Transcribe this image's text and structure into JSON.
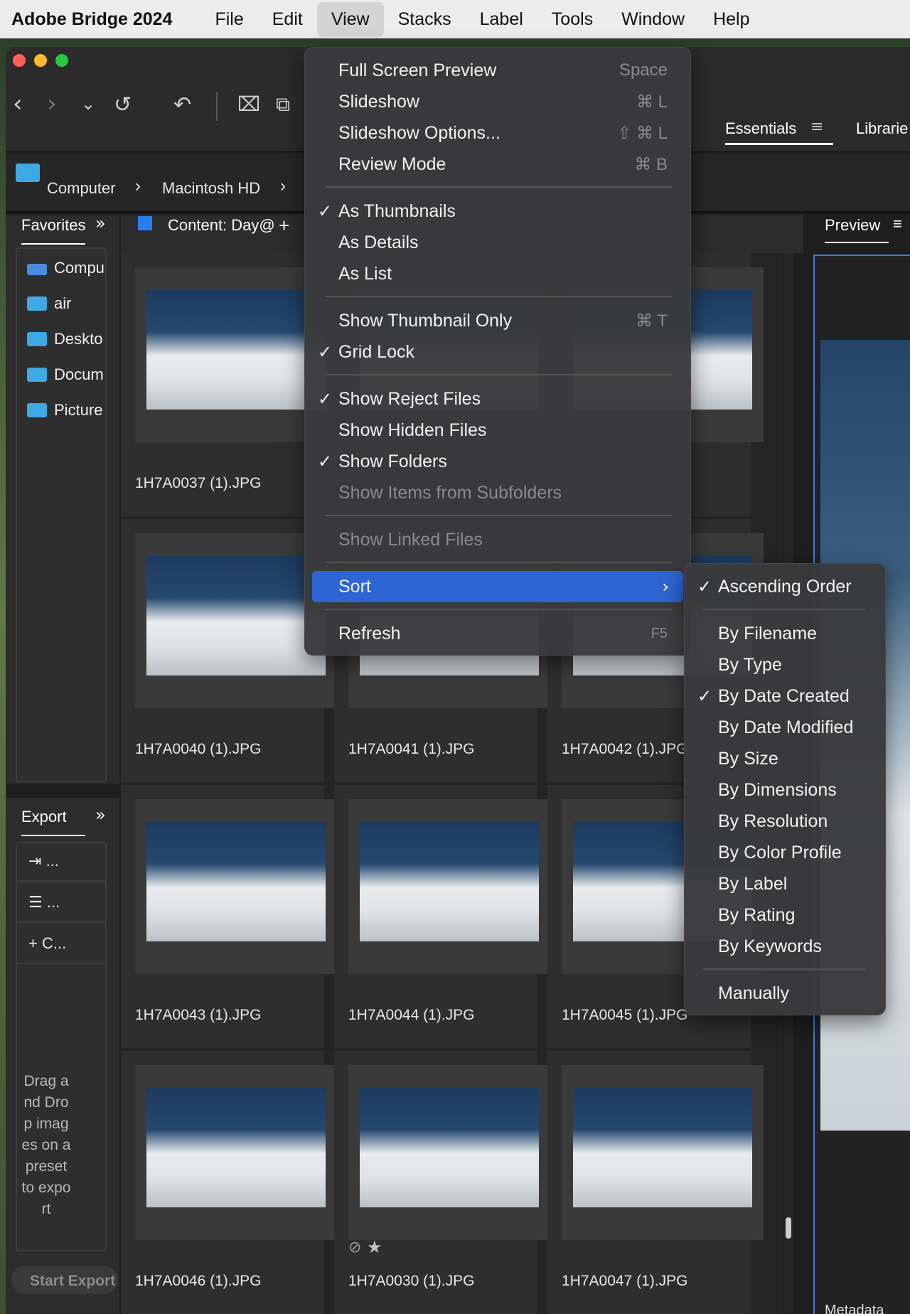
{
  "menubar": {
    "app_name": "Adobe Bridge 2024",
    "items": [
      "File",
      "Edit",
      "View",
      "Stacks",
      "Label",
      "Tools",
      "Window",
      "Help"
    ],
    "active": "View"
  },
  "toolbar": {
    "workspace_tab": "Essentials",
    "libraries_tab": "Librarie"
  },
  "path_bar": {
    "items": [
      "Computer",
      "Macintosh HD"
    ]
  },
  "favorites": {
    "title": "Favorites",
    "items": [
      {
        "label": "Compu",
        "icon": "computer-icon"
      },
      {
        "label": "air",
        "icon": "home-folder-icon"
      },
      {
        "label": "Deskto",
        "icon": "desktop-folder-icon"
      },
      {
        "label": "Docum",
        "icon": "documents-folder-icon"
      },
      {
        "label": "Picture",
        "icon": "pictures-folder-icon"
      }
    ]
  },
  "content": {
    "tab_label": "Content: Day@",
    "files": [
      "1H7A0037 (1).JPG",
      "",
      "",
      "1H7A0040 (1).JPG",
      "1H7A0041 (1).JPG",
      "1H7A0042 (1).JPG",
      "1H7A0043 (1).JPG",
      "1H7A0044 (1).JPG",
      "1H7A0045 (1).JPG",
      "1H7A0046 (1).JPG",
      "1H7A0030 (1).JPG",
      "1H7A0047 (1).JPG"
    ]
  },
  "export": {
    "title": "Export",
    "items": [
      "...",
      "...",
      "C..."
    ],
    "drop_hint": "Drag and Drop images on a preset to export",
    "start_button": "Start Export"
  },
  "preview": {
    "title": "Preview",
    "metadata_tab": "Metadata"
  },
  "view_menu": {
    "items": [
      {
        "label": "Full Screen Preview",
        "shortcut": "Space",
        "checked": false,
        "disabled": false
      },
      {
        "label": "Slideshow",
        "shortcut": "⌘ L",
        "checked": false,
        "disabled": false
      },
      {
        "label": "Slideshow Options...",
        "shortcut": "⇧ ⌘ L",
        "checked": false,
        "disabled": false
      },
      {
        "label": "Review Mode",
        "shortcut": "⌘ B",
        "checked": false,
        "disabled": false
      },
      {
        "label": "As Thumbnails",
        "shortcut": "",
        "checked": true,
        "disabled": false
      },
      {
        "label": "As Details",
        "shortcut": "",
        "checked": false,
        "disabled": false
      },
      {
        "label": "As List",
        "shortcut": "",
        "checked": false,
        "disabled": false
      },
      {
        "label": "Show Thumbnail Only",
        "shortcut": "⌘ T",
        "checked": false,
        "disabled": false
      },
      {
        "label": "Grid Lock",
        "shortcut": "",
        "checked": true,
        "disabled": false
      },
      {
        "label": "Show Reject Files",
        "shortcut": "",
        "checked": true,
        "disabled": false
      },
      {
        "label": "Show Hidden Files",
        "shortcut": "",
        "checked": false,
        "disabled": false
      },
      {
        "label": "Show Folders",
        "shortcut": "",
        "checked": true,
        "disabled": false
      },
      {
        "label": "Show Items from Subfolders",
        "shortcut": "",
        "checked": false,
        "disabled": true
      },
      {
        "label": "Show Linked Files",
        "shortcut": "",
        "checked": false,
        "disabled": true
      },
      {
        "label": "Sort",
        "shortcut": "",
        "checked": false,
        "disabled": false,
        "highlighted": true
      },
      {
        "label": "Refresh",
        "shortcut": "F5",
        "checked": false,
        "disabled": false
      }
    ]
  },
  "sort_submenu": {
    "items": [
      {
        "label": "Ascending Order",
        "checked": true
      },
      {
        "label": "By Filename",
        "checked": false
      },
      {
        "label": "By Type",
        "checked": false
      },
      {
        "label": "By Date Created",
        "checked": true
      },
      {
        "label": "By Date Modified",
        "checked": false
      },
      {
        "label": "By Size",
        "checked": false
      },
      {
        "label": "By Dimensions",
        "checked": false
      },
      {
        "label": "By Resolution",
        "checked": false
      },
      {
        "label": "By Color Profile",
        "checked": false
      },
      {
        "label": "By Label",
        "checked": false
      },
      {
        "label": "By Rating",
        "checked": false
      },
      {
        "label": "By Keywords",
        "checked": false
      },
      {
        "label": "Manually",
        "checked": false
      }
    ]
  },
  "colors": {
    "menu_highlight": "#2d66d4",
    "folder_icon": "#3fa9e6",
    "preview_border": "#3d7dd8"
  }
}
